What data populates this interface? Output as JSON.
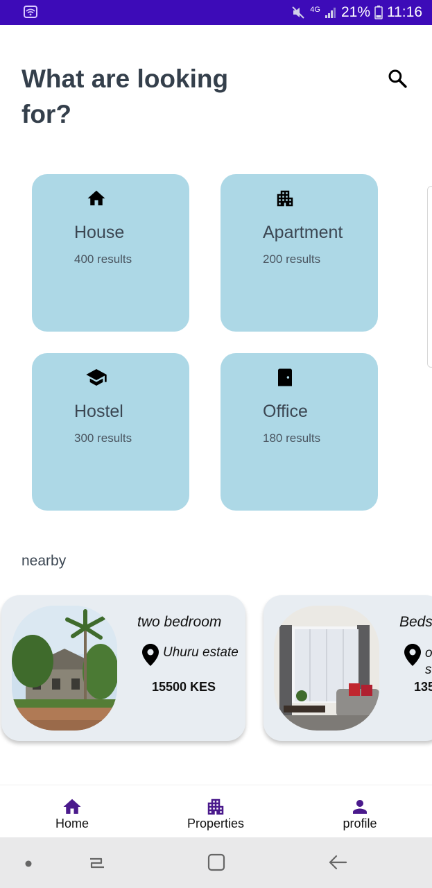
{
  "status_bar": {
    "network": "4G",
    "battery": "21%",
    "time": "11:16",
    "color": "#3d0bb8"
  },
  "header": {
    "title": "What are looking for?",
    "search_icon": "search-icon"
  },
  "categories": [
    {
      "name": "House",
      "count": "400 results",
      "icon": "home-icon"
    },
    {
      "name": "Apartment",
      "count": "200 results",
      "icon": "apartment-icon"
    },
    {
      "name": "Hostel",
      "count": "300 results",
      "icon": "school-icon"
    },
    {
      "name": "Office",
      "count": "180 results",
      "icon": "door-icon"
    }
  ],
  "nearby": {
    "label": "nearby",
    "items": [
      {
        "title": "two bedroom",
        "location": "Uhuru estate",
        "price": "15500 KES"
      },
      {
        "title": "Beds",
        "location": "o s",
        "price": "135"
      }
    ]
  },
  "bottom_nav": [
    {
      "label": "Home",
      "icon": "home-icon"
    },
    {
      "label": "Properties",
      "icon": "apartment-icon"
    },
    {
      "label": "profile",
      "icon": "person-icon"
    }
  ],
  "colors": {
    "accent": "#4a1a8c",
    "card_bg": "#add8e6",
    "title": "#343f4b"
  }
}
